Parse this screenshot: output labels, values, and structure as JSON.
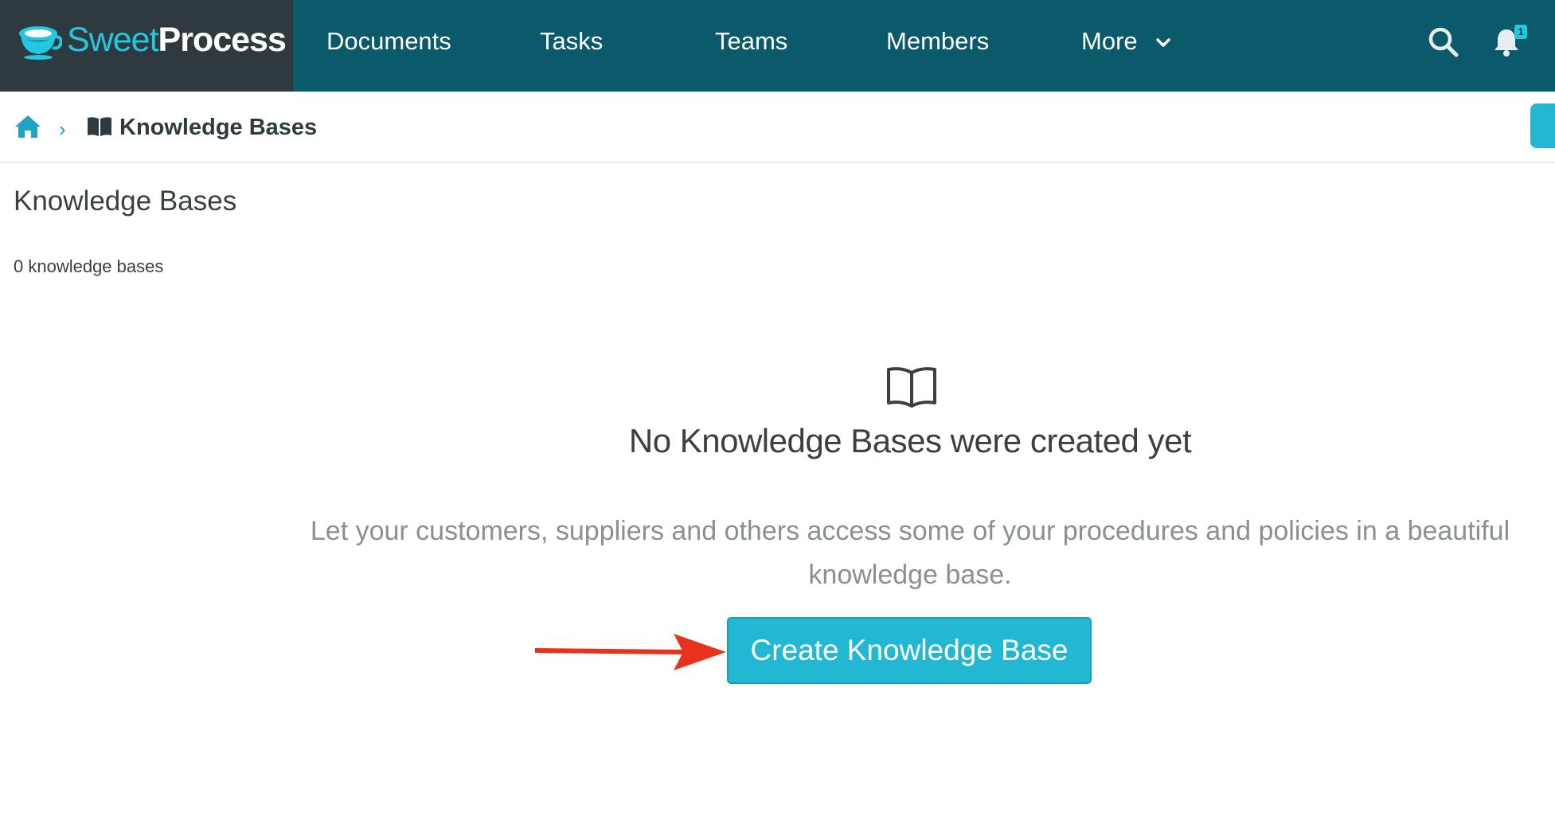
{
  "brand": {
    "name_part1": "Sweet",
    "name_part2": "Process",
    "accent_color": "#22c7e0",
    "logo_icon": "teacup-logo-icon"
  },
  "nav": {
    "items": [
      {
        "label": "Documents"
      },
      {
        "label": "Tasks"
      },
      {
        "label": "Teams"
      },
      {
        "label": "Members"
      },
      {
        "label": "More"
      }
    ],
    "search_icon": "search-icon",
    "notification_icon": "bell-icon",
    "notification_count": "1",
    "background_color": "#0b5a6b"
  },
  "breadcrumb": {
    "home_icon": "home-icon",
    "separator": "›",
    "section_icon": "book-icon",
    "current": "Knowledge Bases"
  },
  "page": {
    "title": "Knowledge Bases",
    "count_text": "0 knowledge bases"
  },
  "empty_state": {
    "icon": "open-book-icon",
    "title": "No Knowledge Bases were created yet",
    "description": "Let your customers, suppliers and others access some of your procedures and policies in a beautiful knowledge base.",
    "button_label": "Create Knowledge Base",
    "button_color": "#22b8d4",
    "annotation": "red-arrow-pointer"
  }
}
